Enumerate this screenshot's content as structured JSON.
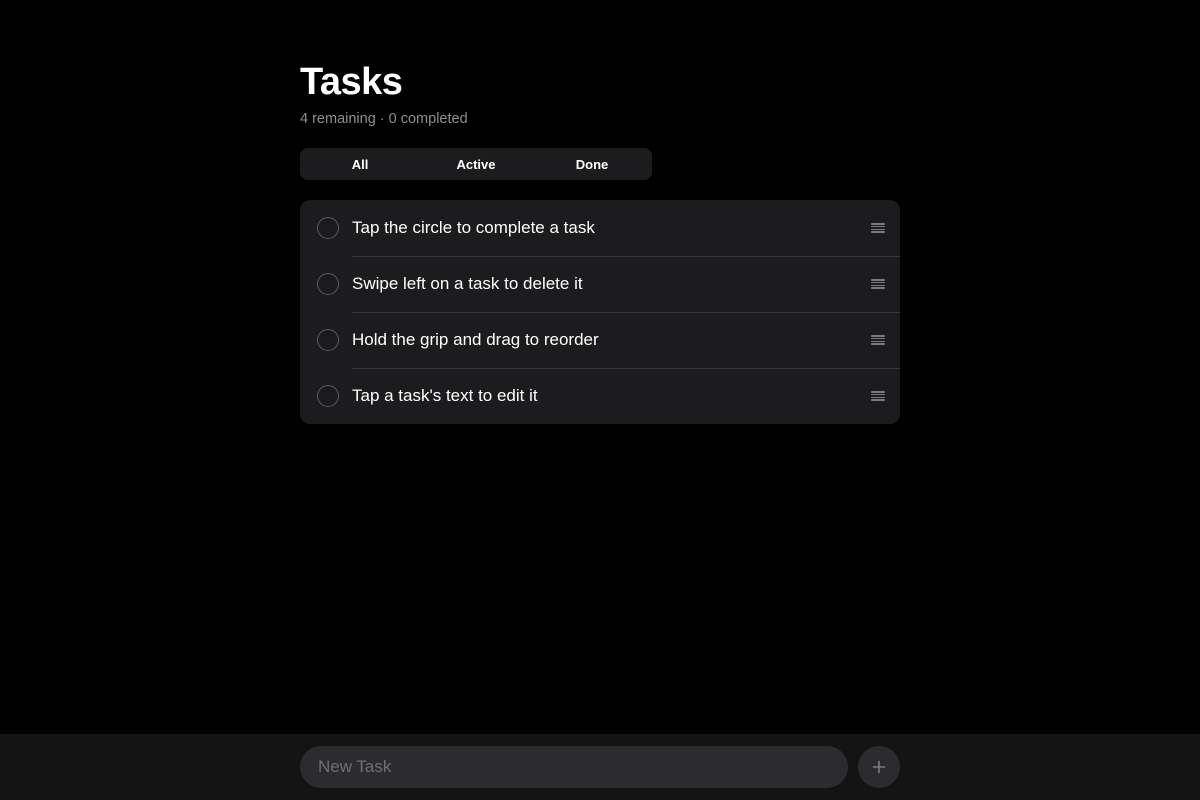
{
  "header": {
    "title": "Tasks",
    "subtitle": "4 remaining · 0 completed"
  },
  "filters": {
    "selected": "All",
    "items": [
      {
        "label": "All"
      },
      {
        "label": "Active"
      },
      {
        "label": "Done"
      }
    ]
  },
  "tasks": [
    {
      "text": "Tap the circle to complete a task",
      "completed": false,
      "icon": "grip-icon"
    },
    {
      "text": "Swipe left on a task to delete it",
      "completed": false,
      "icon": "grip-icon"
    },
    {
      "text": "Hold the grip and drag to reorder",
      "completed": false,
      "icon": "grip-icon"
    },
    {
      "text": "Tap a task's text to edit it",
      "completed": false,
      "icon": "grip-icon"
    }
  ],
  "composer": {
    "placeholder": "New Task",
    "value": "",
    "add_icon": "plus-icon"
  },
  "colors": {
    "background": "#000000",
    "card": "#1c1c1e",
    "secondary_text": "#8e8e93",
    "input_background": "#2c2c2e"
  }
}
